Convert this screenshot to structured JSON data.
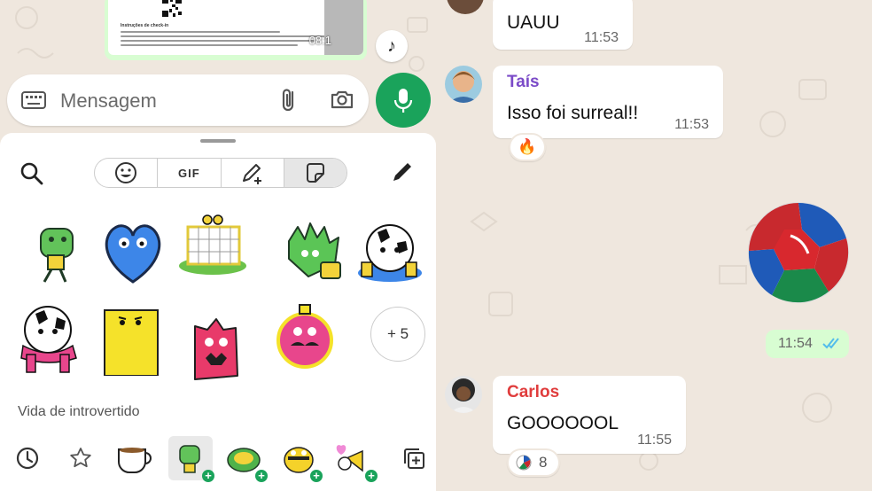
{
  "left": {
    "doc_preview": {
      "title": "Instruções de check-in",
      "time": "08:1"
    },
    "composer": {
      "placeholder": "Mensagem"
    },
    "sticker_tray": {
      "tabs": [
        "emoji",
        "GIF",
        "avatar-sticker",
        "sticker"
      ],
      "gif_label": "GIF",
      "active_tab": "sticker",
      "more_label": "+ 5",
      "pack_name": "Vida de introvertido"
    }
  },
  "right": {
    "messages": [
      {
        "text": "UAUU",
        "time": "11:53"
      },
      {
        "sender": "Taís",
        "sender_color": "#7b4bc8",
        "text": "Isso foi surreal!!",
        "time": "11:53",
        "reaction": "🔥"
      },
      {
        "outgoing_time": "11:54",
        "status": "read"
      },
      {
        "sender": "Carlos",
        "sender_color": "#e03d3d",
        "text": "GOOOOOOL",
        "time": "11:55",
        "reaction_count": "8"
      }
    ]
  },
  "colors": {
    "accent": "#1aa35b",
    "chat_bg": "#efe7de",
    "outgoing": "#d8fdd2",
    "read_ticks": "#53bdeb"
  }
}
